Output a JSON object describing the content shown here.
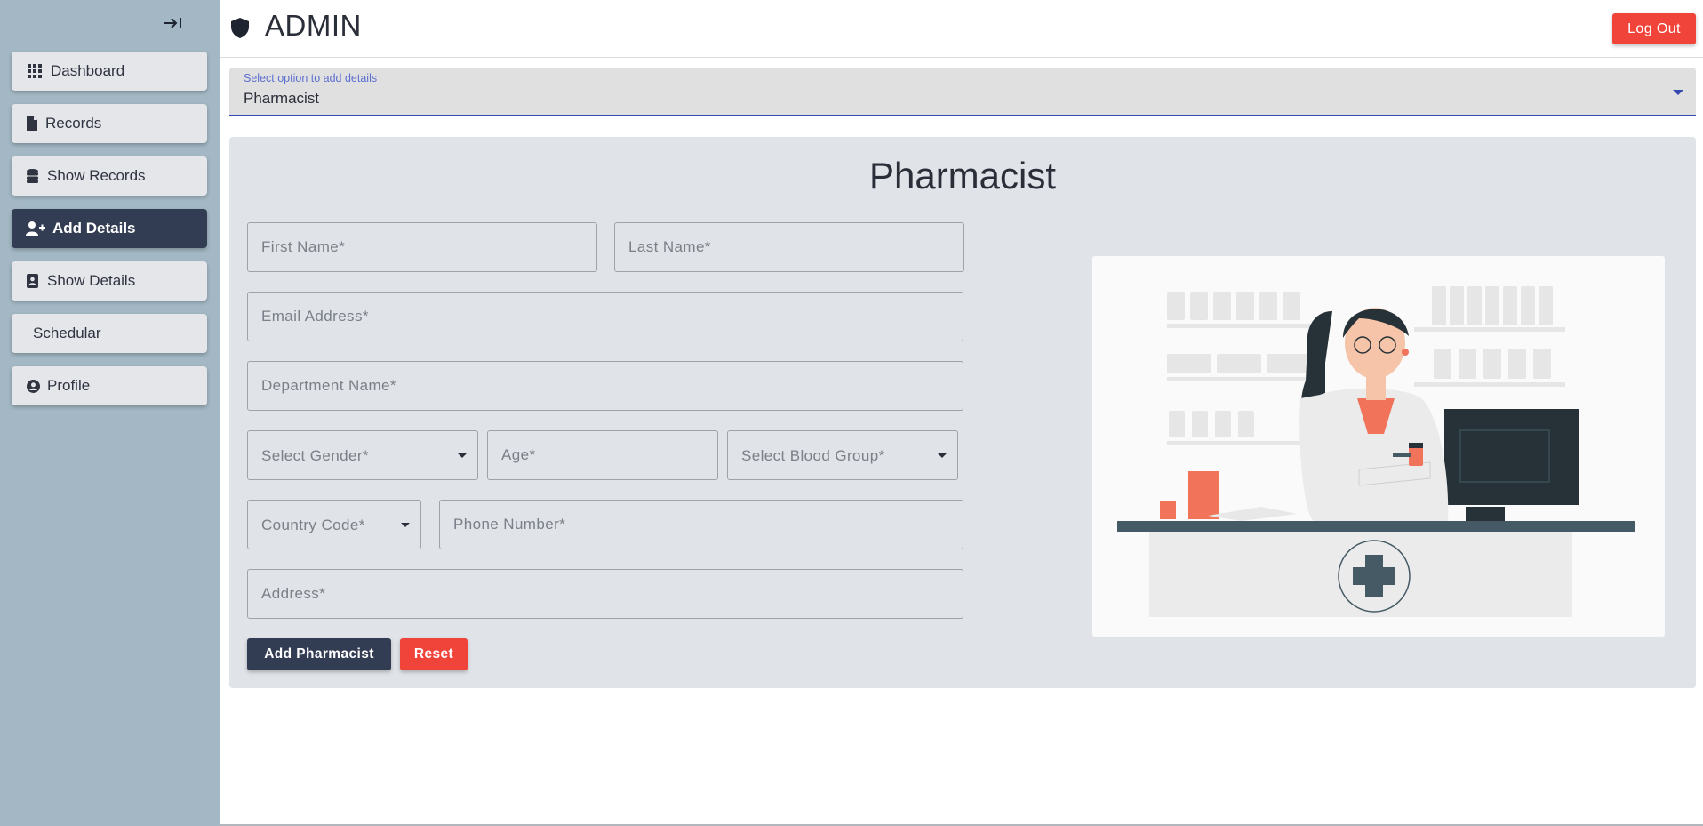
{
  "header": {
    "title": "ADMIN",
    "logout_label": "Log Out"
  },
  "sidebar": {
    "items": [
      {
        "label": "Dashboard",
        "icon": "grid-icon"
      },
      {
        "label": "Records",
        "icon": "file-icon"
      },
      {
        "label": "Show Records",
        "icon": "database-icon"
      },
      {
        "label": "Add Details",
        "icon": "add-user-icon",
        "active": true
      },
      {
        "label": "Show Details",
        "icon": "contact-card-icon"
      },
      {
        "label": "Schedular",
        "icon": ""
      },
      {
        "label": "Profile",
        "icon": "user-circle-icon"
      }
    ]
  },
  "option_select": {
    "label": "Select option to add details",
    "value": "Pharmacist"
  },
  "form": {
    "title": "Pharmacist",
    "first_name_placeholder": "First Name*",
    "last_name_placeholder": "Last Name*",
    "email_placeholder": "Email Address*",
    "department_placeholder": "Department Name*",
    "gender_label": "Select Gender*",
    "age_placeholder": "Age*",
    "blood_group_label": "Select Blood Group*",
    "country_code_label": "Country Code*",
    "phone_placeholder": "Phone Number*",
    "address_placeholder": "Address*",
    "add_button": "Add Pharmacist",
    "reset_button": "Reset"
  },
  "colors": {
    "sidebar_bg": "#a3b8c4",
    "active_nav": "#323c52",
    "danger": "#f0433a",
    "accent": "#3347b0",
    "panel_bg": "#e0e3e8"
  }
}
